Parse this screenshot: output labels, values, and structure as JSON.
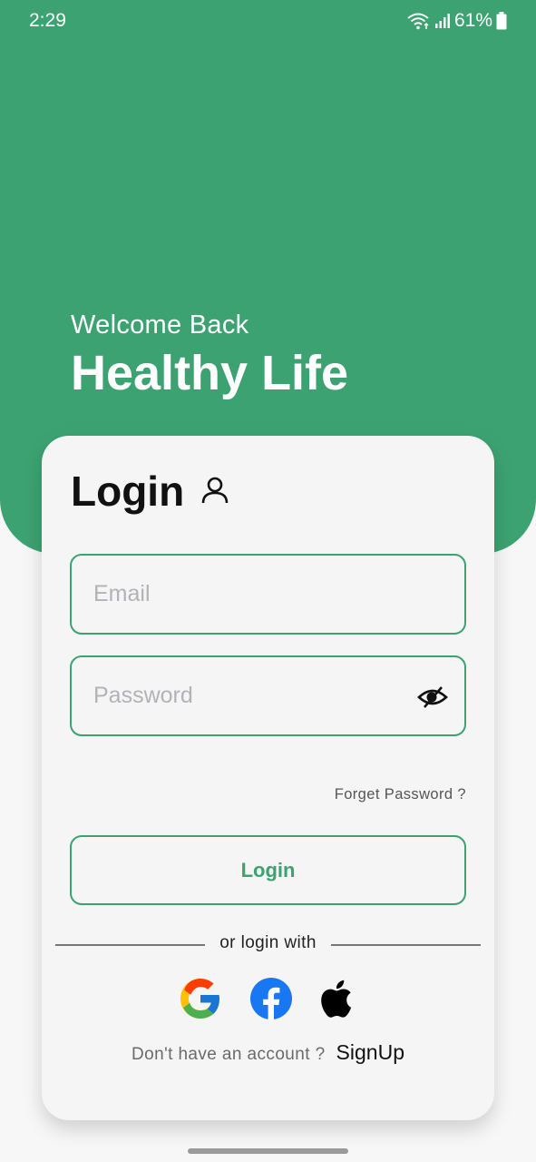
{
  "status_bar": {
    "time": "2:29",
    "battery": "61%"
  },
  "hero": {
    "welcome": "Welcome Back",
    "app_name": "Healthy Life"
  },
  "login_card": {
    "title": "Login",
    "email_placeholder": "Email",
    "password_placeholder": "Password",
    "forgot_password": "Forget Password ?",
    "login_button": "Login",
    "divider_text": "or login with",
    "social_providers": [
      "google-icon",
      "facebook-icon",
      "apple-icon"
    ],
    "signup_question": "Don't have an account ?",
    "signup_link": "SignUp"
  },
  "colors": {
    "primary": "#3da271",
    "card_bg": "#f5f5f5",
    "facebook": "#1877f2"
  }
}
